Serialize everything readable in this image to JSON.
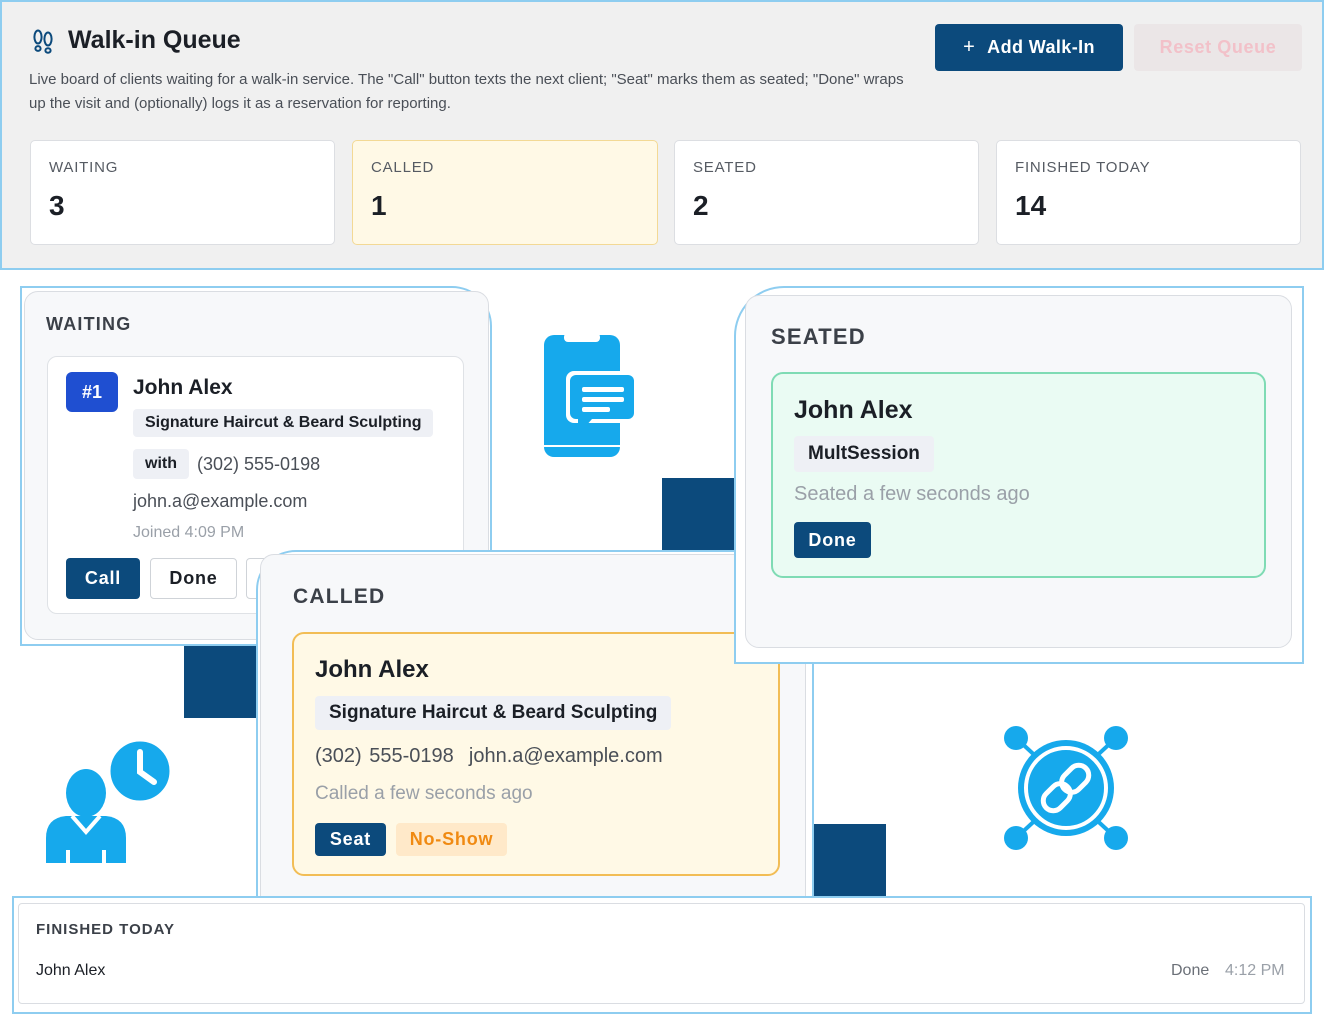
{
  "header": {
    "title": "Walk-in Queue",
    "description": "Live board of clients waiting for a walk-in service. The \"Call\" button texts the next client; \"Seat\" marks them as seated; \"Done\" wraps up the visit and (optionally) logs it as a reservation for reporting.",
    "add_button": "Add Walk-In",
    "add_icon": "+",
    "reset_button": "Reset Queue",
    "title_icon": "footprints-icon"
  },
  "stats": [
    {
      "label": "WAITING",
      "value": "3"
    },
    {
      "label": "CALLED",
      "value": "1"
    },
    {
      "label": "SEATED",
      "value": "2"
    },
    {
      "label": "FINISHED TODAY",
      "value": "14"
    }
  ],
  "waiting": {
    "heading": "WAITING",
    "card": {
      "number": "#1",
      "name": "John Alex",
      "service": "Signature Haircut & Beard Sculpting",
      "with_label": "with",
      "phone": "(302) 555-0198",
      "email": "john.a@example.com",
      "joined": "Joined 4:09 PM",
      "call_button": "Call",
      "done_button": "Done"
    }
  },
  "called": {
    "heading": "CALLED",
    "card": {
      "name": "John Alex",
      "service": "Signature Haircut & Beard Sculpting",
      "phone": "(302) 555-0198",
      "email": "john.a@example.com",
      "status": "Called a few seconds ago",
      "seat_button": "Seat",
      "noshow_button": "No-Show"
    }
  },
  "seated": {
    "heading": "SEATED",
    "card": {
      "name": "John Alex",
      "service": "MultSession",
      "status": "Seated a few seconds ago",
      "done_button": "Done"
    }
  },
  "finished": {
    "heading": "FINISHED TODAY",
    "rows": [
      {
        "name": "John Alex",
        "status": "Done",
        "time": "4:12 PM"
      }
    ]
  },
  "decor_icons": [
    "sms-phone-icon",
    "user-clock-icon",
    "link-network-icon"
  ],
  "colors": {
    "accent": "#0c4a7c",
    "badge": "#1f4fd1",
    "icon": "#16a9ec",
    "called_bg": "#fff9e6",
    "called_border": "#f2bd55",
    "seated_bg": "#eafbf3",
    "seated_border": "#7fdbb4",
    "noshow": "#f08a12"
  }
}
